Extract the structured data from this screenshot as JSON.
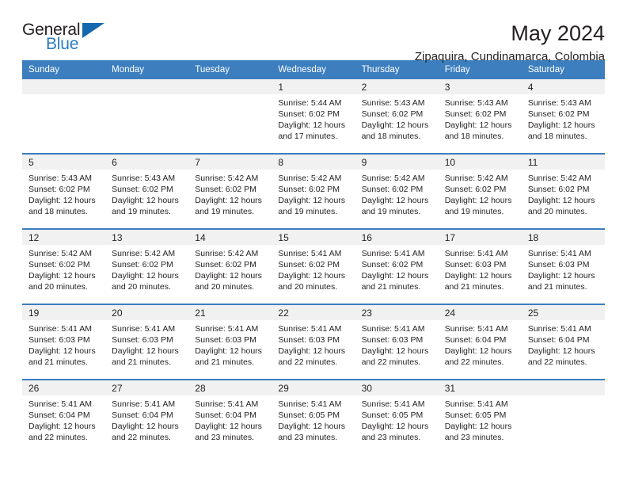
{
  "brand": {
    "name_part1": "General",
    "name_part2": "Blue",
    "triangle_icon": "triangle-logo-icon",
    "color_dark": "#231f20",
    "color_blue": "#2b7cc0"
  },
  "header": {
    "title": "May 2024",
    "subtitle": "Zipaquira, Cundinamarca, Colombia"
  },
  "theme": {
    "header_row_bg": "#3c7ebe",
    "daynum_bg": "#f1f1f1",
    "separator": "#3c7ebe",
    "text": "#231f20"
  },
  "weekday_headers": [
    "Sunday",
    "Monday",
    "Tuesday",
    "Wednesday",
    "Thursday",
    "Friday",
    "Saturday"
  ],
  "weeks": [
    {
      "days": [
        {
          "num": "",
          "sunrise": "",
          "sunset": "",
          "daylight_line1": "",
          "daylight_line2": ""
        },
        {
          "num": "",
          "sunrise": "",
          "sunset": "",
          "daylight_line1": "",
          "daylight_line2": ""
        },
        {
          "num": "",
          "sunrise": "",
          "sunset": "",
          "daylight_line1": "",
          "daylight_line2": ""
        },
        {
          "num": "1",
          "sunrise": "Sunrise: 5:44 AM",
          "sunset": "Sunset: 6:02 PM",
          "daylight_line1": "Daylight: 12 hours",
          "daylight_line2": "and 17 minutes."
        },
        {
          "num": "2",
          "sunrise": "Sunrise: 5:43 AM",
          "sunset": "Sunset: 6:02 PM",
          "daylight_line1": "Daylight: 12 hours",
          "daylight_line2": "and 18 minutes."
        },
        {
          "num": "3",
          "sunrise": "Sunrise: 5:43 AM",
          "sunset": "Sunset: 6:02 PM",
          "daylight_line1": "Daylight: 12 hours",
          "daylight_line2": "and 18 minutes."
        },
        {
          "num": "4",
          "sunrise": "Sunrise: 5:43 AM",
          "sunset": "Sunset: 6:02 PM",
          "daylight_line1": "Daylight: 12 hours",
          "daylight_line2": "and 18 minutes."
        }
      ]
    },
    {
      "days": [
        {
          "num": "5",
          "sunrise": "Sunrise: 5:43 AM",
          "sunset": "Sunset: 6:02 PM",
          "daylight_line1": "Daylight: 12 hours",
          "daylight_line2": "and 18 minutes."
        },
        {
          "num": "6",
          "sunrise": "Sunrise: 5:43 AM",
          "sunset": "Sunset: 6:02 PM",
          "daylight_line1": "Daylight: 12 hours",
          "daylight_line2": "and 19 minutes."
        },
        {
          "num": "7",
          "sunrise": "Sunrise: 5:42 AM",
          "sunset": "Sunset: 6:02 PM",
          "daylight_line1": "Daylight: 12 hours",
          "daylight_line2": "and 19 minutes."
        },
        {
          "num": "8",
          "sunrise": "Sunrise: 5:42 AM",
          "sunset": "Sunset: 6:02 PM",
          "daylight_line1": "Daylight: 12 hours",
          "daylight_line2": "and 19 minutes."
        },
        {
          "num": "9",
          "sunrise": "Sunrise: 5:42 AM",
          "sunset": "Sunset: 6:02 PM",
          "daylight_line1": "Daylight: 12 hours",
          "daylight_line2": "and 19 minutes."
        },
        {
          "num": "10",
          "sunrise": "Sunrise: 5:42 AM",
          "sunset": "Sunset: 6:02 PM",
          "daylight_line1": "Daylight: 12 hours",
          "daylight_line2": "and 19 minutes."
        },
        {
          "num": "11",
          "sunrise": "Sunrise: 5:42 AM",
          "sunset": "Sunset: 6:02 PM",
          "daylight_line1": "Daylight: 12 hours",
          "daylight_line2": "and 20 minutes."
        }
      ]
    },
    {
      "days": [
        {
          "num": "12",
          "sunrise": "Sunrise: 5:42 AM",
          "sunset": "Sunset: 6:02 PM",
          "daylight_line1": "Daylight: 12 hours",
          "daylight_line2": "and 20 minutes."
        },
        {
          "num": "13",
          "sunrise": "Sunrise: 5:42 AM",
          "sunset": "Sunset: 6:02 PM",
          "daylight_line1": "Daylight: 12 hours",
          "daylight_line2": "and 20 minutes."
        },
        {
          "num": "14",
          "sunrise": "Sunrise: 5:42 AM",
          "sunset": "Sunset: 6:02 PM",
          "daylight_line1": "Daylight: 12 hours",
          "daylight_line2": "and 20 minutes."
        },
        {
          "num": "15",
          "sunrise": "Sunrise: 5:41 AM",
          "sunset": "Sunset: 6:02 PM",
          "daylight_line1": "Daylight: 12 hours",
          "daylight_line2": "and 20 minutes."
        },
        {
          "num": "16",
          "sunrise": "Sunrise: 5:41 AM",
          "sunset": "Sunset: 6:02 PM",
          "daylight_line1": "Daylight: 12 hours",
          "daylight_line2": "and 21 minutes."
        },
        {
          "num": "17",
          "sunrise": "Sunrise: 5:41 AM",
          "sunset": "Sunset: 6:03 PM",
          "daylight_line1": "Daylight: 12 hours",
          "daylight_line2": "and 21 minutes."
        },
        {
          "num": "18",
          "sunrise": "Sunrise: 5:41 AM",
          "sunset": "Sunset: 6:03 PM",
          "daylight_line1": "Daylight: 12 hours",
          "daylight_line2": "and 21 minutes."
        }
      ]
    },
    {
      "days": [
        {
          "num": "19",
          "sunrise": "Sunrise: 5:41 AM",
          "sunset": "Sunset: 6:03 PM",
          "daylight_line1": "Daylight: 12 hours",
          "daylight_line2": "and 21 minutes."
        },
        {
          "num": "20",
          "sunrise": "Sunrise: 5:41 AM",
          "sunset": "Sunset: 6:03 PM",
          "daylight_line1": "Daylight: 12 hours",
          "daylight_line2": "and 21 minutes."
        },
        {
          "num": "21",
          "sunrise": "Sunrise: 5:41 AM",
          "sunset": "Sunset: 6:03 PM",
          "daylight_line1": "Daylight: 12 hours",
          "daylight_line2": "and 21 minutes."
        },
        {
          "num": "22",
          "sunrise": "Sunrise: 5:41 AM",
          "sunset": "Sunset: 6:03 PM",
          "daylight_line1": "Daylight: 12 hours",
          "daylight_line2": "and 22 minutes."
        },
        {
          "num": "23",
          "sunrise": "Sunrise: 5:41 AM",
          "sunset": "Sunset: 6:03 PM",
          "daylight_line1": "Daylight: 12 hours",
          "daylight_line2": "and 22 minutes."
        },
        {
          "num": "24",
          "sunrise": "Sunrise: 5:41 AM",
          "sunset": "Sunset: 6:04 PM",
          "daylight_line1": "Daylight: 12 hours",
          "daylight_line2": "and 22 minutes."
        },
        {
          "num": "25",
          "sunrise": "Sunrise: 5:41 AM",
          "sunset": "Sunset: 6:04 PM",
          "daylight_line1": "Daylight: 12 hours",
          "daylight_line2": "and 22 minutes."
        }
      ]
    },
    {
      "days": [
        {
          "num": "26",
          "sunrise": "Sunrise: 5:41 AM",
          "sunset": "Sunset: 6:04 PM",
          "daylight_line1": "Daylight: 12 hours",
          "daylight_line2": "and 22 minutes."
        },
        {
          "num": "27",
          "sunrise": "Sunrise: 5:41 AM",
          "sunset": "Sunset: 6:04 PM",
          "daylight_line1": "Daylight: 12 hours",
          "daylight_line2": "and 22 minutes."
        },
        {
          "num": "28",
          "sunrise": "Sunrise: 5:41 AM",
          "sunset": "Sunset: 6:04 PM",
          "daylight_line1": "Daylight: 12 hours",
          "daylight_line2": "and 23 minutes."
        },
        {
          "num": "29",
          "sunrise": "Sunrise: 5:41 AM",
          "sunset": "Sunset: 6:05 PM",
          "daylight_line1": "Daylight: 12 hours",
          "daylight_line2": "and 23 minutes."
        },
        {
          "num": "30",
          "sunrise": "Sunrise: 5:41 AM",
          "sunset": "Sunset: 6:05 PM",
          "daylight_line1": "Daylight: 12 hours",
          "daylight_line2": "and 23 minutes."
        },
        {
          "num": "31",
          "sunrise": "Sunrise: 5:41 AM",
          "sunset": "Sunset: 6:05 PM",
          "daylight_line1": "Daylight: 12 hours",
          "daylight_line2": "and 23 minutes."
        },
        {
          "num": "",
          "sunrise": "",
          "sunset": "",
          "daylight_line1": "",
          "daylight_line2": ""
        }
      ]
    }
  ]
}
